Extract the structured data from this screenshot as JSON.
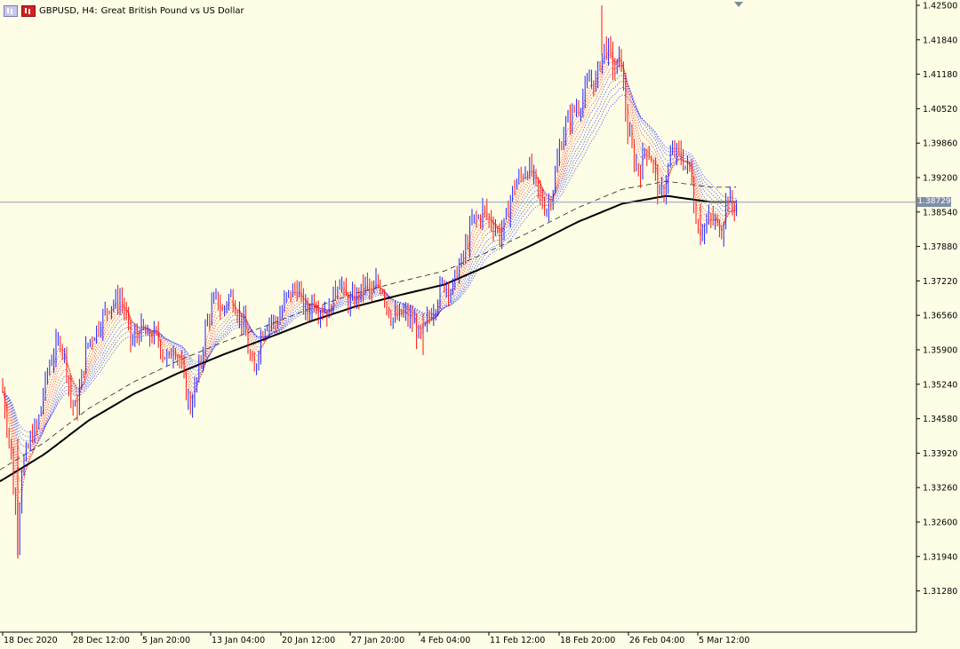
{
  "header": {
    "symbol_label": "GBPUSD, H4:",
    "description": "Great British Pound vs US Dollar",
    "icons": [
      "chart-type-icon",
      "symbol-flag-icon"
    ]
  },
  "current_price": "1.38729",
  "colors": {
    "background": "#fefee6",
    "bull": "#2020ff",
    "bear": "#ff1010",
    "ma_fast": "#ff2020",
    "ma_slow": "#2020ff",
    "ma_long": "#000000",
    "price_line": "#8f9bb0"
  },
  "chart_data": {
    "type": "candlestick",
    "symbol": "GBPUSD",
    "timeframe": "H4",
    "y_ticks": [
      "1.42500",
      "1.41840",
      "1.41180",
      "1.40520",
      "1.39860",
      "1.39200",
      "1.38540",
      "1.37880",
      "1.37220",
      "1.36560",
      "1.35900",
      "1.35240",
      "1.34580",
      "1.33920",
      "1.33260",
      "1.32600",
      "1.31940",
      "1.31280"
    ],
    "ylim": [
      1.3062,
      1.425
    ],
    "x_ticks": [
      "18 Dec 2020",
      "28 Dec 12:00",
      "5 Jan 20:00",
      "13 Jan 04:00",
      "20 Jan 12:00",
      "27 Jan 20:00",
      "4 Feb 04:00",
      "11 Feb 12:00",
      "18 Feb 20:00",
      "26 Feb 04:00",
      "5 Mar 12:00"
    ],
    "price_line": 1.38729,
    "price_path": [
      [
        0,
        1.355
      ],
      [
        6,
        1.347
      ],
      [
        12,
        1.34
      ],
      [
        16,
        1.33
      ],
      [
        20,
        1.323
      ],
      [
        24,
        1.336
      ],
      [
        30,
        1.339
      ],
      [
        36,
        1.343
      ],
      [
        42,
        1.344
      ],
      [
        48,
        1.35
      ],
      [
        55,
        1.356
      ],
      [
        62,
        1.359
      ],
      [
        68,
        1.361
      ],
      [
        74,
        1.357
      ],
      [
        80,
        1.349
      ],
      [
        86,
        1.347
      ],
      [
        92,
        1.354
      ],
      [
        98,
        1.36
      ],
      [
        105,
        1.362
      ],
      [
        112,
        1.364
      ],
      [
        118,
        1.366
      ],
      [
        124,
        1.368
      ],
      [
        130,
        1.368
      ],
      [
        136,
        1.369
      ],
      [
        142,
        1.365
      ],
      [
        148,
        1.36
      ],
      [
        154,
        1.362
      ],
      [
        160,
        1.363
      ],
      [
        166,
        1.361
      ],
      [
        172,
        1.362
      ],
      [
        178,
        1.361
      ],
      [
        184,
        1.358
      ],
      [
        190,
        1.357
      ],
      [
        196,
        1.36
      ],
      [
        202,
        1.357
      ],
      [
        208,
        1.352
      ],
      [
        214,
        1.348
      ],
      [
        220,
        1.352
      ],
      [
        226,
        1.357
      ],
      [
        232,
        1.364
      ],
      [
        238,
        1.367
      ],
      [
        244,
        1.369
      ],
      [
        250,
        1.366
      ],
      [
        256,
        1.369
      ],
      [
        262,
        1.369
      ],
      [
        268,
        1.366
      ],
      [
        274,
        1.364
      ],
      [
        280,
        1.358
      ],
      [
        286,
        1.354
      ],
      [
        292,
        1.361
      ],
      [
        298,
        1.364
      ],
      [
        304,
        1.365
      ],
      [
        310,
        1.364
      ],
      [
        316,
        1.366
      ],
      [
        322,
        1.369
      ],
      [
        328,
        1.37
      ],
      [
        334,
        1.371
      ],
      [
        340,
        1.368
      ],
      [
        346,
        1.366
      ],
      [
        352,
        1.369
      ],
      [
        358,
        1.367
      ],
      [
        364,
        1.367
      ],
      [
        370,
        1.366
      ],
      [
        376,
        1.37
      ],
      [
        382,
        1.373
      ],
      [
        388,
        1.369
      ],
      [
        394,
        1.368
      ],
      [
        400,
        1.369
      ],
      [
        406,
        1.37
      ],
      [
        412,
        1.372
      ],
      [
        418,
        1.369
      ],
      [
        424,
        1.372
      ],
      [
        430,
        1.371
      ],
      [
        436,
        1.367
      ],
      [
        442,
        1.365
      ],
      [
        448,
        1.365
      ],
      [
        454,
        1.366
      ],
      [
        460,
        1.365
      ],
      [
        466,
        1.364
      ],
      [
        472,
        1.361
      ],
      [
        478,
        1.363
      ],
      [
        484,
        1.366
      ],
      [
        490,
        1.368
      ],
      [
        496,
        1.371
      ],
      [
        502,
        1.372
      ],
      [
        508,
        1.37
      ],
      [
        514,
        1.374
      ],
      [
        520,
        1.376
      ],
      [
        526,
        1.38
      ],
      [
        532,
        1.384
      ],
      [
        538,
        1.384
      ],
      [
        544,
        1.386
      ],
      [
        550,
        1.384
      ],
      [
        556,
        1.383
      ],
      [
        562,
        1.381
      ],
      [
        568,
        1.383
      ],
      [
        574,
        1.388
      ],
      [
        580,
        1.391
      ],
      [
        586,
        1.392
      ],
      [
        592,
        1.394
      ],
      [
        598,
        1.393
      ],
      [
        604,
        1.39
      ],
      [
        610,
        1.387
      ],
      [
        616,
        1.386
      ],
      [
        622,
        1.39
      ],
      [
        628,
        1.396
      ],
      [
        634,
        1.401
      ],
      [
        640,
        1.403
      ],
      [
        646,
        1.405
      ],
      [
        652,
        1.406
      ],
      [
        658,
        1.408
      ],
      [
        664,
        1.411
      ],
      [
        670,
        1.41
      ],
      [
        676,
        1.415
      ],
      [
        680,
        1.417
      ],
      [
        686,
        1.416
      ],
      [
        692,
        1.412
      ],
      [
        698,
        1.416
      ],
      [
        702,
        1.408
      ],
      [
        706,
        1.401
      ],
      [
        710,
        1.398
      ],
      [
        714,
        1.395
      ],
      [
        720,
        1.393
      ],
      [
        726,
        1.398
      ],
      [
        732,
        1.396
      ],
      [
        738,
        1.392
      ],
      [
        742,
        1.388
      ],
      [
        748,
        1.39
      ],
      [
        754,
        1.396
      ],
      [
        760,
        1.397
      ],
      [
        766,
        1.396
      ],
      [
        772,
        1.394
      ],
      [
        778,
        1.393
      ],
      [
        782,
        1.384
      ],
      [
        788,
        1.382
      ],
      [
        794,
        1.383
      ],
      [
        800,
        1.384
      ],
      [
        806,
        1.383
      ],
      [
        812,
        1.382
      ],
      [
        818,
        1.389
      ],
      [
        824,
        1.386
      ],
      [
        830,
        1.388
      ]
    ],
    "ma_long_path": [
      [
        0,
        1.3338
      ],
      [
        50,
        1.339
      ],
      [
        100,
        1.3455
      ],
      [
        150,
        1.3505
      ],
      [
        200,
        1.3545
      ],
      [
        250,
        1.358
      ],
      [
        300,
        1.3612
      ],
      [
        350,
        1.3645
      ],
      [
        400,
        1.3673
      ],
      [
        450,
        1.3695
      ],
      [
        500,
        1.3715
      ],
      [
        550,
        1.3752
      ],
      [
        600,
        1.3792
      ],
      [
        650,
        1.3835
      ],
      [
        700,
        1.387
      ],
      [
        750,
        1.3885
      ],
      [
        800,
        1.3873
      ],
      [
        830,
        1.3873
      ]
    ]
  }
}
